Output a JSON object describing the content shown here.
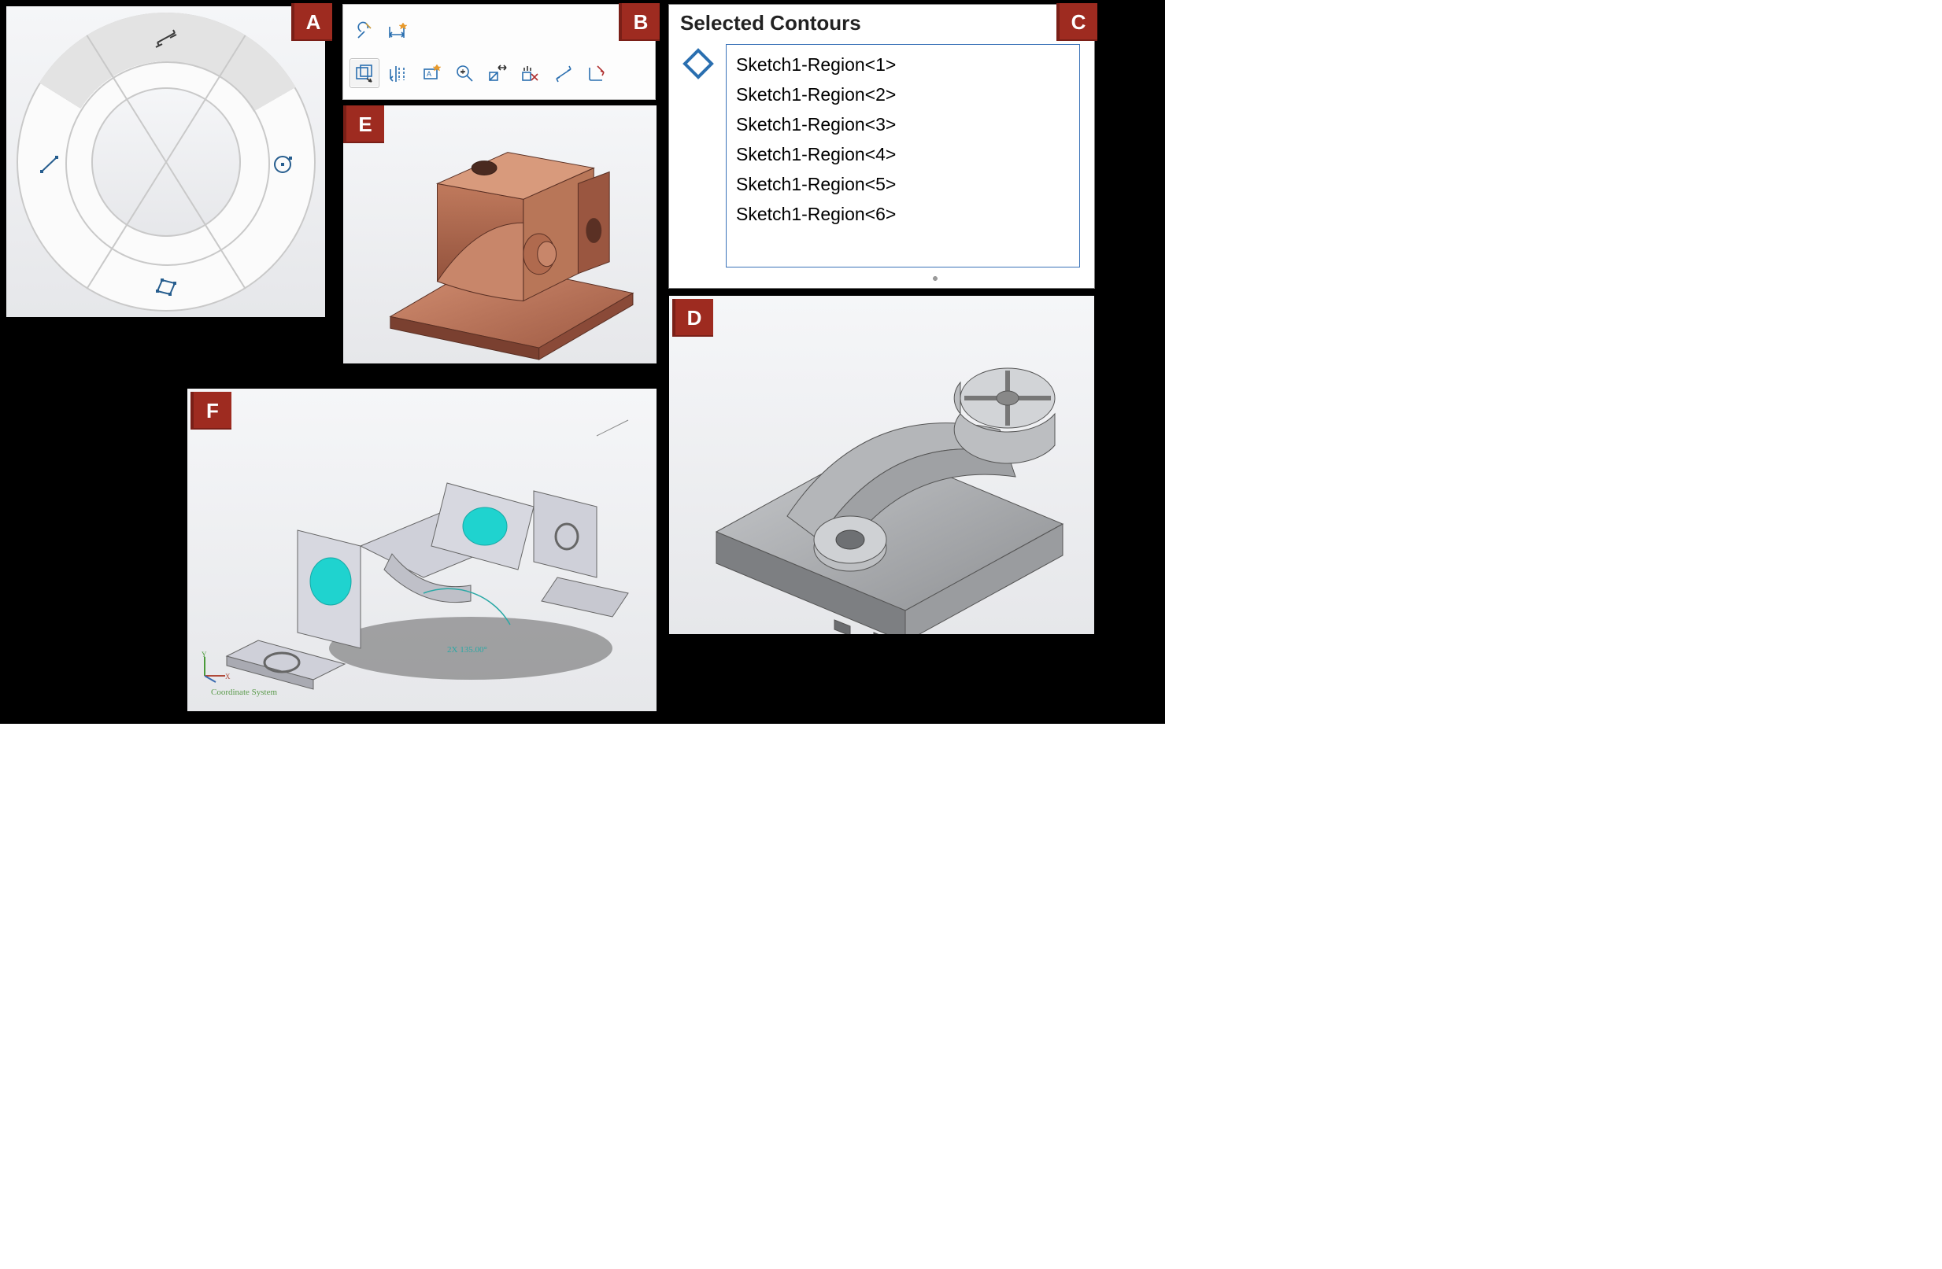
{
  "tags": {
    "a": "A",
    "b": "B",
    "c": "C",
    "d": "D",
    "e": "E",
    "f": "F"
  },
  "ring": {
    "tool_top": "smart-dimension-icon",
    "tool_right": "circle-icon",
    "tool_bottom": "rectangle-icon",
    "tool_left": "line-icon"
  },
  "toolbar": {
    "row1": [
      "fix-relation-icon",
      "smart-dimension-icon"
    ],
    "row2": [
      "instant2d-icon",
      "shaded-sketch-contours-icon",
      "auto-scale-icon",
      "zoom-to-fit-icon",
      "add-relation-icon",
      "clear-relations-icon",
      "measure-icon",
      "exit-sketch-icon"
    ],
    "active_index": 0
  },
  "contours": {
    "title": "Selected Contours",
    "items": [
      "Sketch1-Region<1>",
      "Sketch1-Region<2>",
      "Sketch1-Region<3>",
      "Sketch1-Region<4>",
      "Sketch1-Region<5>",
      "Sketch1-Region<6>"
    ]
  },
  "panelE": {
    "note": "copper-colored solid model, isometric"
  },
  "panelD": {
    "note": "gray mold-cavity solid model, isometric"
  },
  "panelF": {
    "note": "sheet-metal bracket isometric with cyan face highlights",
    "coord_label": "Coordinate System",
    "angle_annotation": "2X 135.00°"
  }
}
